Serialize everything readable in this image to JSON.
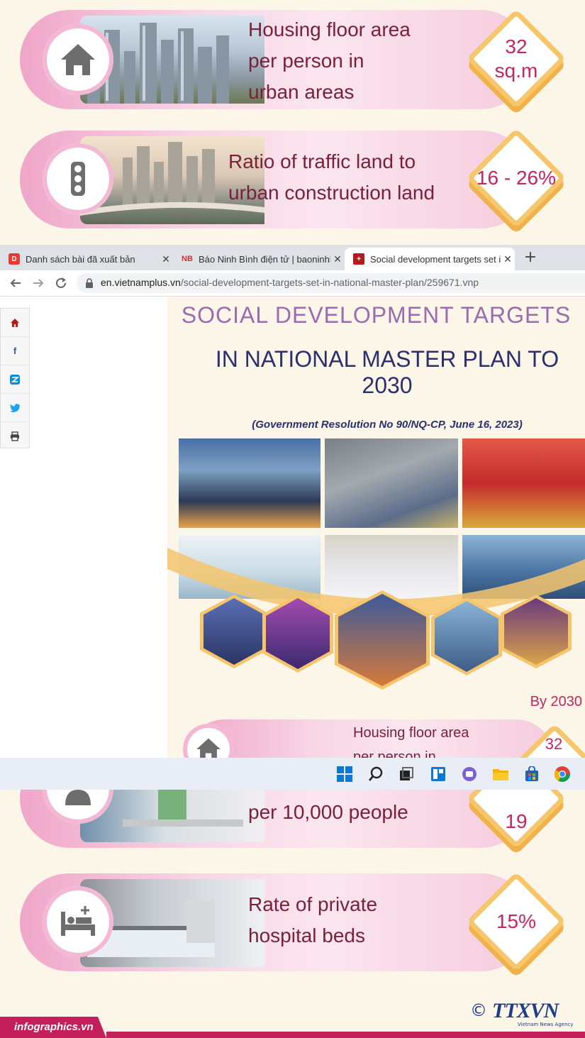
{
  "infographic": {
    "cards_top": [
      {
        "label_lines": [
          "Housing floor area",
          "per person in",
          "urban areas"
        ],
        "value_lines": [
          "32",
          "sq.m"
        ],
        "icon": "house-icon"
      },
      {
        "label_lines": [
          "Ratio of traffic land to",
          "urban construction land"
        ],
        "value_lines": [
          "16 - 26%"
        ],
        "icon": "traffic-light-icon"
      }
    ],
    "cards_bottom": [
      {
        "label_lines": [
          "per 10,000 people"
        ],
        "value_lines": [
          "19"
        ],
        "icon": "doctor-icon"
      },
      {
        "label_lines": [
          "Rate of private",
          "hospital beds"
        ],
        "value_lines": [
          "15%"
        ],
        "icon": "hospital-bed-icon"
      }
    ],
    "footer": {
      "brand": "infographics.vn",
      "copyright": "©",
      "agency_logo": "TTXVN",
      "agency_sub": "Vietnam News Agency"
    }
  },
  "browser": {
    "tabs": [
      {
        "title": "Danh sách bài đã xuất bản",
        "favicon": "D",
        "favicon_color": "#e53935",
        "active": false
      },
      {
        "title": "Báo Ninh Bình điện tử | baoninhbinh",
        "favicon": "NB",
        "favicon_color": "#d32f2f",
        "active": false
      },
      {
        "title": "Social development targets set in",
        "favicon": "+",
        "favicon_color": "#b71c1c",
        "active": true
      }
    ],
    "new_tab": "+",
    "url_host": "en.vietnamplus.vn",
    "url_path": "/social-development-targets-set-in-national-master-plan/259671.vnp"
  },
  "page": {
    "share_icons": [
      "home-icon",
      "facebook-icon",
      "zalo-icon",
      "twitter-icon",
      "print-icon"
    ],
    "title_line1": "SOCIAL DEVELOPMENT TARGETS",
    "title_line2": "IN NATIONAL MASTER PLAN TO 2030",
    "subtitle": "(Government Resolution No 90/NQ-CP, June 16, 2023)",
    "by_year": "By 2030",
    "preview_card": {
      "label_lines": [
        "Housing floor area",
        "per person in"
      ],
      "value": "32"
    }
  },
  "taskbar_icons": [
    "windows-start-icon",
    "search-icon",
    "task-view-icon",
    "widgets-icon",
    "chat-icon",
    "file-explorer-icon",
    "store-icon",
    "chrome-icon"
  ],
  "colors": {
    "accent_pink": "#c8245d",
    "label_maroon": "#7a1f3a",
    "diamond_gold": "#f6c66b",
    "title_navy": "#2b2f6e"
  }
}
